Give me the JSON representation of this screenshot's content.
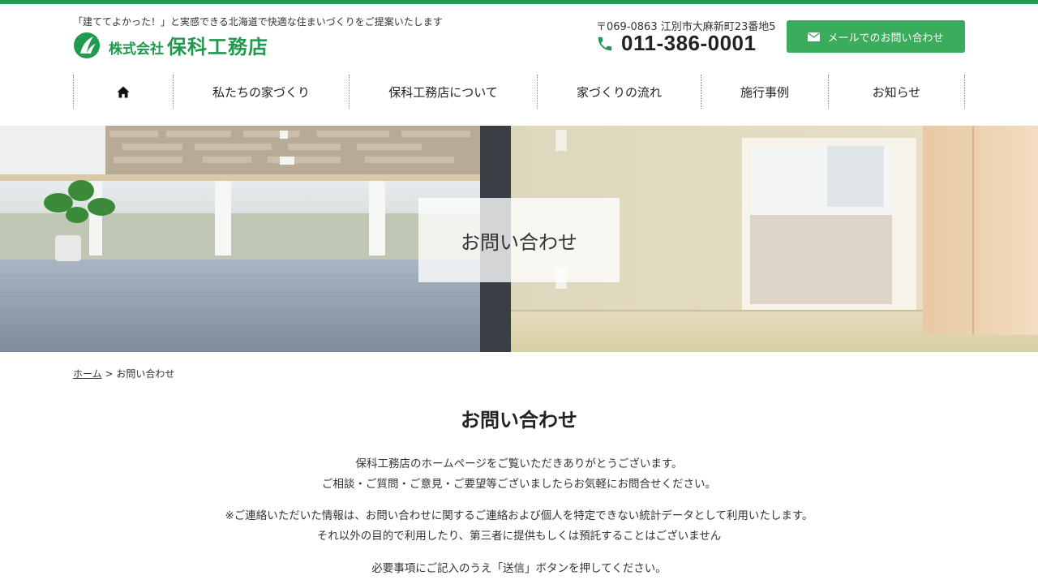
{
  "header": {
    "tagline": "「建ててよかった！」と実感できる北海道で快適な住まいづくりをご提案いたします",
    "logo_prefix": "株式会社",
    "logo_name": "保科工務店",
    "address": "〒069-0863 江別市大麻新町23番地5",
    "phone": "011-386-0001",
    "mail_button": "メールでのお問い合わせ",
    "brand_color": "#1f9a4e",
    "button_color": "#3aac5c"
  },
  "nav": {
    "home_icon": "home-icon",
    "items": [
      {
        "label": "私たちの家づくり"
      },
      {
        "label": "保科工務店について"
      },
      {
        "label": "家づくりの流れ"
      },
      {
        "label": "施行事例"
      },
      {
        "label": "お知らせ"
      }
    ]
  },
  "hero": {
    "title": "お問い合わせ"
  },
  "breadcrumb": {
    "home": "ホーム",
    "separator": ">",
    "current": "お問い合わせ"
  },
  "main": {
    "title": "お問い合わせ",
    "intro_line1": "保科工務店のホームページをご覧いただきありがとうございます。",
    "intro_line2": "ご相談・ご質問・ご意見・ご要望等ございましたらお気軽にお問合せください。",
    "notice_line1": "※ご連絡いただいた情報は、お問い合わせに関するご連絡および個人を特定できない統計データとして利用いたします。",
    "notice_line2": "それ以外の目的で利用したり、第三者に提供もしくは預託することはございません",
    "instruction": "必要事項にご記入のうえ「送信」ボタンを押してください。"
  }
}
